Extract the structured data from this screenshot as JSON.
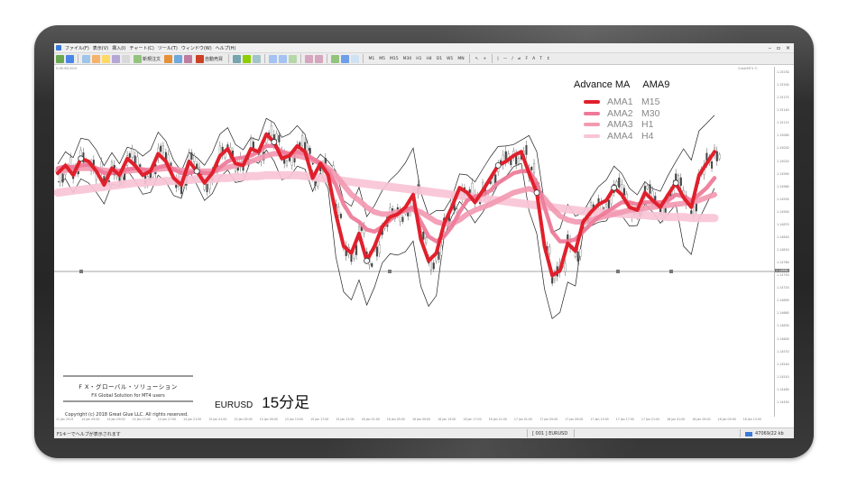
{
  "menu": [
    "ファイル(F)",
    "表示(V)",
    "挿入(I)",
    "チャート(C)",
    "ツール(T)",
    "ウィンドウ(W)",
    "ヘルプ(H)"
  ],
  "toolbar": {
    "new_order": "新規注文",
    "auto_trading": "自動売買",
    "timeframes": [
      "M1",
      "M5",
      "M15",
      "M30",
      "H1",
      "H4",
      "D1",
      "W1",
      "MN"
    ]
  },
  "chart": {
    "header": "EURUSD,M15",
    "corner": "GreatMT4 ©",
    "price_labels": [
      "1.15230",
      "1.15200",
      "1.15175",
      "1.15140",
      "1.15115",
      "1.15080",
      "1.15050",
      "1.15020",
      "1.14990",
      "1.14960",
      "1.14930",
      "1.14900",
      "1.14870",
      "1.14840",
      "1.14810",
      "1.14780",
      "1.14750",
      "1.14720",
      "1.14690",
      "1.14660",
      "1.14630",
      "1.14600",
      "1.14570",
      "1.14540",
      "1.14510",
      "1.14480",
      "1.14450"
    ],
    "current_price": "1.14880",
    "time_labels": [
      "11 Jan 2019",
      "14 Jan 05:00",
      "14 Jan 09:00",
      "14 Jan 13:00",
      "14 Jan 17:00",
      "14 Jan 21:00",
      "15 Jan 01:00",
      "15 Jan 05:00",
      "15 Jan 09:00",
      "15 Jan 13:00",
      "15 Jan 17:00",
      "15 Jan 21:00",
      "16 Jan 01:00",
      "16 Jan 05:00",
      "16 Jan 09:00",
      "16 Jan 13:00",
      "16 Jan 17:00",
      "16 Jan 21:00",
      "17 Jan 01:00",
      "17 Jan 05:00",
      "17 Jan 09:00",
      "17 Jan 13:00",
      "17 Jan 17:00",
      "17 Jan 21:00",
      "18 Jan 01:00",
      "18 Jan 05:00",
      "18 Jan 09:00",
      "18 Jan 13:00"
    ]
  },
  "legend": {
    "title_left": "Advance MA",
    "title_right": "AMA9",
    "items": [
      {
        "name": "AMA1",
        "tf": "M15",
        "color": "#e0202c"
      },
      {
        "name": "AMA2",
        "tf": "M30",
        "color": "#ee7a98"
      },
      {
        "name": "AMA3",
        "tf": "H1",
        "color": "#f29ab2"
      },
      {
        "name": "AMA4",
        "tf": "H4",
        "color": "#f8c4d6"
      }
    ]
  },
  "brand": {
    "jp": "F X・グローバル・ソリューション",
    "en": "FX Global Solution for MT4 users",
    "copyright": "Copyright (c) 2018   Great Glue LLC.   All rights reserved."
  },
  "symbol": {
    "name": "EURUSD",
    "timeframe": "15分足"
  },
  "status": {
    "help": "F1キーでヘルプが表示されます",
    "profile": "[ 001 ]  EURUSD",
    "traffic": "47069/22 kb"
  },
  "chart_data": {
    "type": "line",
    "note_series": "overlay of four adaptive moving averages on candlestick chart",
    "series": [
      {
        "name": "AMA1 M15",
        "color": "#e0202c",
        "values": [
          250,
          258,
          248,
          265,
          262,
          252,
          238,
          255,
          248,
          265,
          258,
          248,
          252,
          270,
          262,
          245,
          238,
          262,
          252,
          240,
          250,
          268,
          275,
          260,
          258,
          275,
          272,
          290,
          282,
          265,
          268,
          278,
          272,
          245,
          260,
          248,
          208,
          175,
          168,
          188,
          160,
          175,
          195,
          205,
          208,
          215,
          228,
          182,
          160,
          168,
          198,
          215,
          235,
          230,
          220,
          232,
          245,
          258,
          262,
          268,
          272,
          250,
          230,
          175,
          145,
          150,
          178,
          170,
          200,
          210,
          218,
          222,
          235,
          228,
          215,
          212,
          230,
          222,
          215,
          228,
          240,
          225,
          215,
          248,
          260,
          272
        ]
      },
      {
        "name": "AMA2 M30",
        "color": "#ee7a98",
        "values": [
          255,
          257,
          256,
          258,
          259,
          255,
          250,
          250,
          252,
          254,
          255,
          254,
          252,
          256,
          258,
          254,
          250,
          250,
          252,
          250,
          250,
          256,
          262,
          265,
          266,
          268,
          272,
          278,
          278,
          272,
          270,
          272,
          270,
          265,
          260,
          252,
          238,
          218,
          205,
          200,
          192,
          190,
          195,
          202,
          208,
          212,
          215,
          200,
          185,
          180,
          185,
          195,
          210,
          222,
          226,
          228,
          232,
          240,
          245,
          250,
          252,
          252,
          240,
          215,
          190,
          180,
          180,
          182,
          190,
          198,
          205,
          210,
          215,
          220,
          220,
          218,
          220,
          220,
          220,
          222,
          228,
          226,
          222,
          228,
          235,
          245
        ]
      },
      {
        "name": "AMA3 H1",
        "color": "#f29ab2",
        "values": [
          252,
          253,
          254,
          255,
          255,
          254,
          253,
          252,
          252,
          252,
          253,
          253,
          253,
          254,
          255,
          254,
          253,
          252,
          252,
          252,
          252,
          254,
          256,
          258,
          260,
          262,
          265,
          268,
          270,
          270,
          269,
          268,
          266,
          264,
          260,
          255,
          248,
          238,
          228,
          222,
          215,
          210,
          208,
          208,
          210,
          212,
          213,
          210,
          205,
          200,
          198,
          198,
          202,
          208,
          212,
          215,
          218,
          222,
          226,
          230,
          232,
          234,
          232,
          224,
          214,
          206,
          202,
          200,
          200,
          202,
          204,
          206,
          208,
          210,
          212,
          213,
          214,
          215,
          216,
          217,
          218,
          219,
          220,
          222,
          225,
          228
        ]
      },
      {
        "name": "AMA4 H4",
        "color": "#f8c4d6",
        "values": [
          230,
          231,
          232,
          233,
          234,
          235,
          236,
          237,
          238,
          239,
          240,
          240,
          241,
          241,
          242,
          242,
          243,
          243,
          244,
          244,
          244,
          245,
          245,
          246,
          246,
          247,
          247,
          248,
          248,
          248,
          248,
          248,
          247,
          246,
          245,
          244,
          243,
          242,
          241,
          240,
          239,
          238,
          237,
          236,
          235,
          234,
          233,
          232,
          231,
          230,
          229,
          228,
          227,
          226,
          225,
          224,
          223,
          222,
          221,
          220,
          219,
          218,
          217,
          216,
          215,
          214,
          213,
          212,
          211,
          210,
          210,
          209,
          209,
          208,
          208,
          207,
          207,
          206,
          206,
          205,
          205,
          205,
          204,
          204,
          204,
          204
        ]
      }
    ],
    "current_price": "1.14880",
    "grid": false
  }
}
